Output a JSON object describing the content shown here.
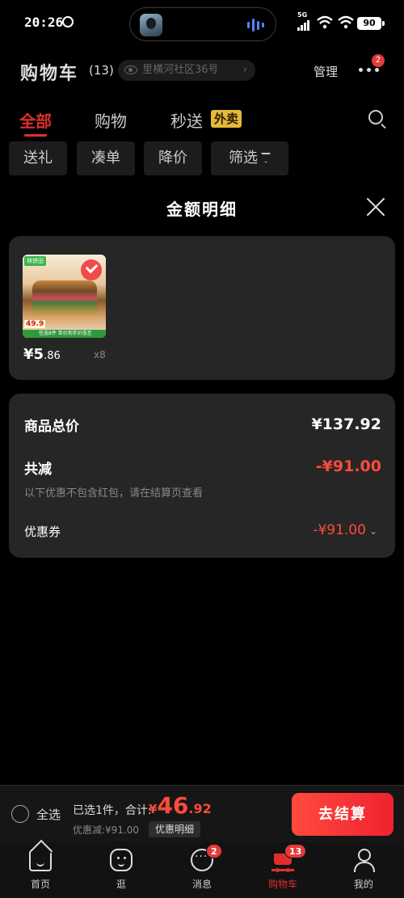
{
  "status_bar": {
    "time": "20:26",
    "network": "5G",
    "battery": "90"
  },
  "header": {
    "title": "购物车",
    "count": "(13)",
    "address": "里横河社区36号",
    "manage": "管理",
    "more_badge": "2"
  },
  "tabs": [
    {
      "label": "全部",
      "active": true
    },
    {
      "label": "购物",
      "active": false
    },
    {
      "label": "秒送",
      "active": false
    }
  ],
  "takeout_badge": "外卖",
  "chips": [
    "送礼",
    "凑单",
    "降价",
    "筛选"
  ],
  "popup": {
    "title": "金额明细",
    "product": {
      "brand": "林饼田",
      "image_price": "49.9",
      "image_strip": "任选8件 单价到手价低至",
      "price_symbol": "¥",
      "price_int": "5",
      "price_dec": ".86",
      "qty": "x8"
    },
    "summary": {
      "total_label": "商品总价",
      "total_value": "¥137.92",
      "reduce_label": "共减",
      "reduce_value": "-¥91.00",
      "note": "以下优惠不包含红包，请在结算页查看",
      "coupon_label": "优惠券",
      "coupon_value": "-¥91.00"
    }
  },
  "bottom_bar": {
    "select_all": "全选",
    "selected_text": "已选1件，合计:",
    "total_symbol": "¥",
    "total_int": "46",
    "total_dec": ".92",
    "discount": "优惠减:¥91.00",
    "detail_btn": "优惠明细",
    "checkout": "去结算"
  },
  "tabbar": [
    {
      "label": "首页",
      "icon": "home-icon",
      "badge": ""
    },
    {
      "label": "逛",
      "icon": "guang-icon",
      "badge": ""
    },
    {
      "label": "消息",
      "icon": "message-icon",
      "badge": "2"
    },
    {
      "label": "购物车",
      "icon": "cart-icon",
      "badge": "13",
      "active": true
    },
    {
      "label": "我的",
      "icon": "profile-icon",
      "badge": ""
    }
  ],
  "colors": {
    "accent": "#e02e2e",
    "price_red": "#ff4b3a",
    "card_bg": "#262626",
    "takeout": "#e2b93a"
  }
}
